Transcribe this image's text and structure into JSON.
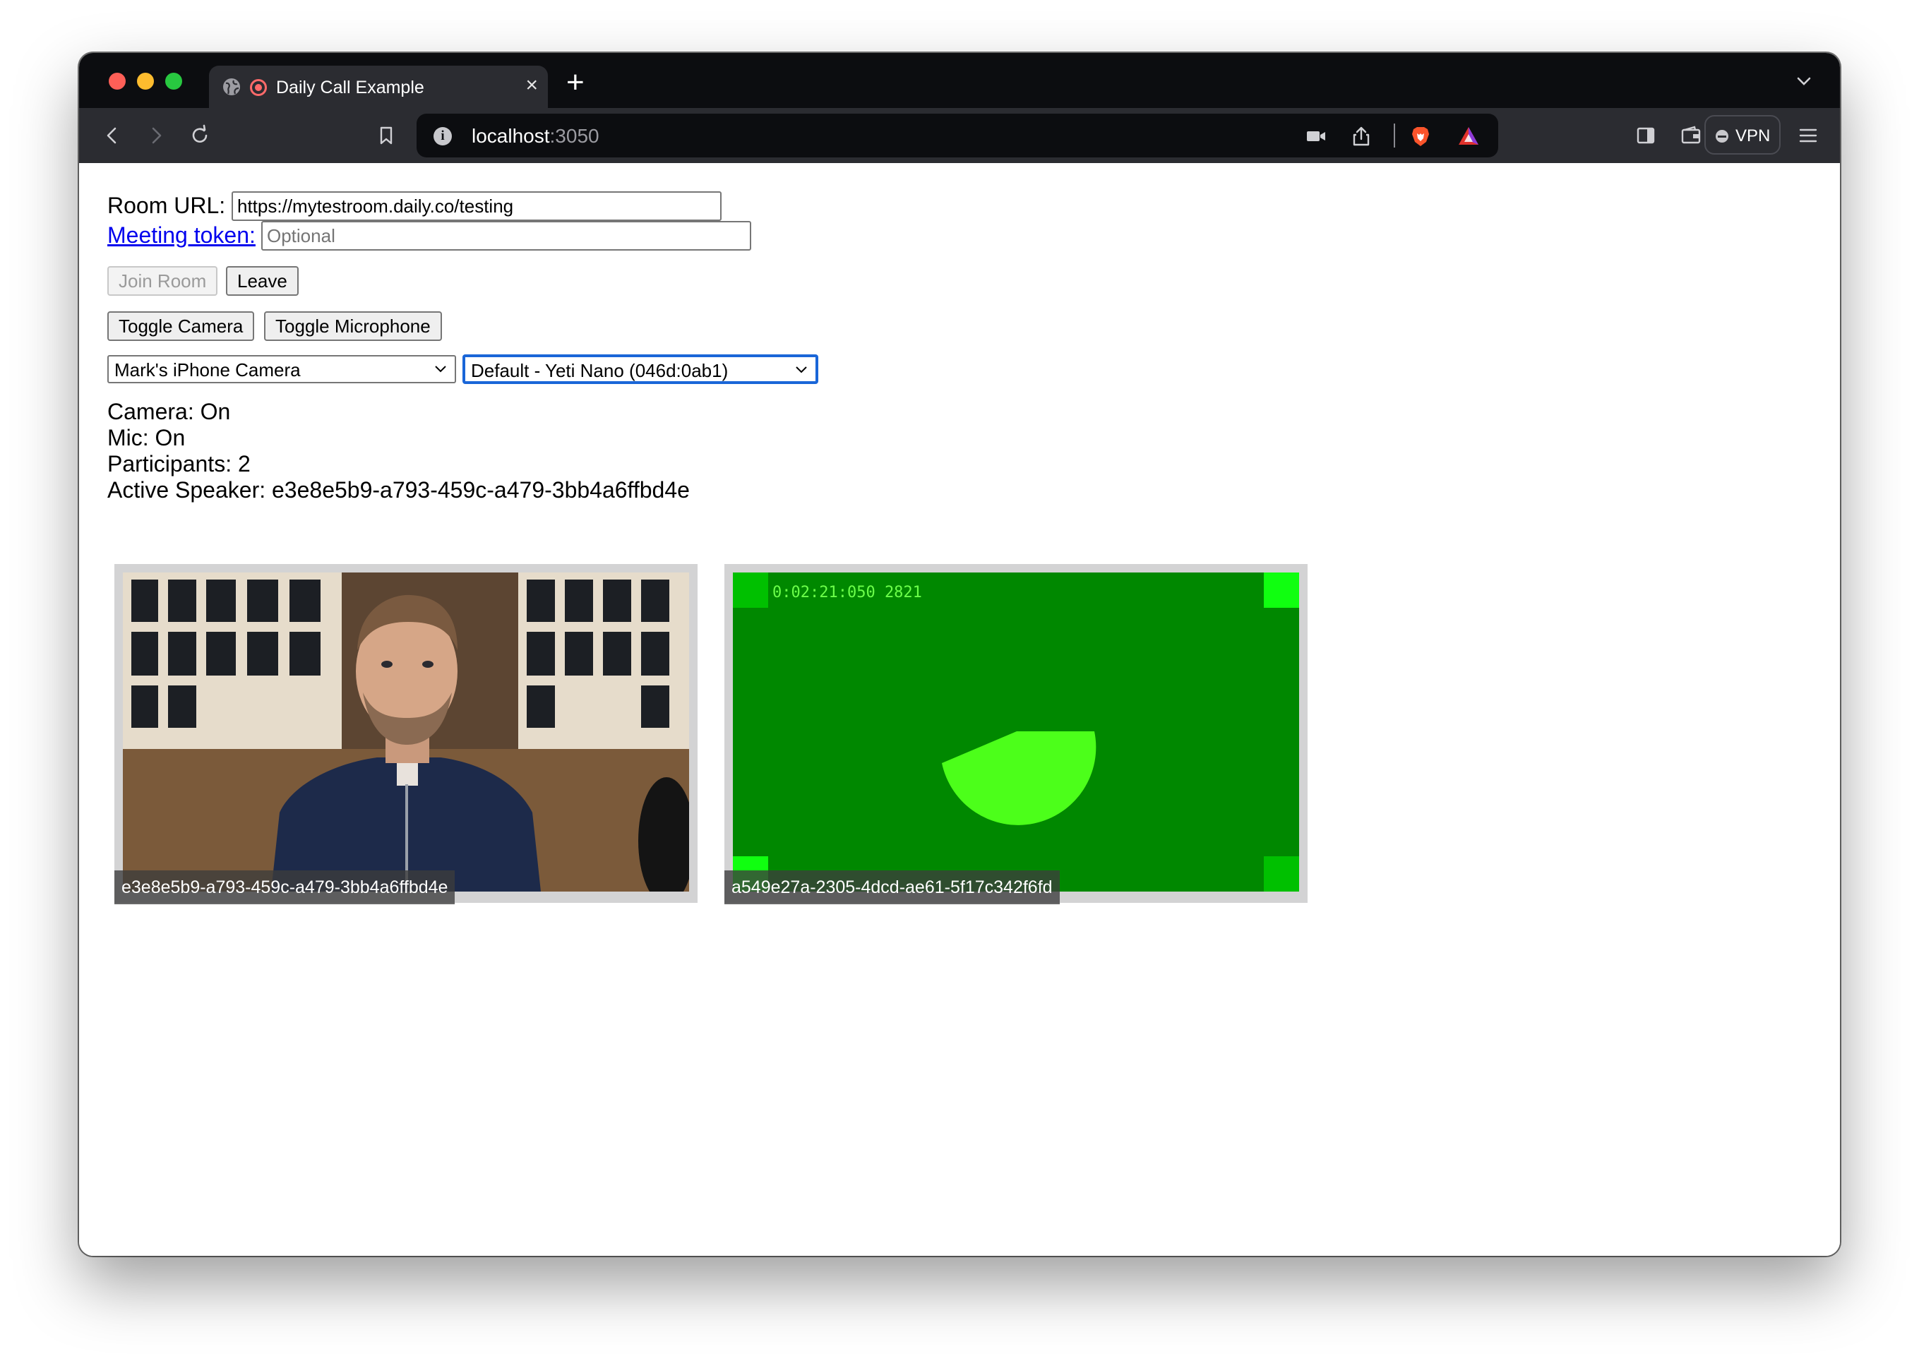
{
  "browser": {
    "tab_title": "Daily Call Example",
    "tab_close": "×",
    "new_tab": "+",
    "url_host": "localhost",
    "url_port": ":3050",
    "vpn_label": "VPN"
  },
  "room": {
    "url_label": "Room URL:",
    "url_value": "https://mytestroom.daily.co/testing",
    "token_label": "Meeting token:",
    "token_placeholder": "Optional"
  },
  "buttons": {
    "join": "Join Room",
    "leave": "Leave",
    "toggle_camera": "Toggle Camera",
    "toggle_microphone": "Toggle Microphone"
  },
  "devices": {
    "camera_selected": "Mark's iPhone Camera",
    "mic_selected": "Default - Yeti Nano (046d:0ab1)"
  },
  "status": {
    "camera": "Camera: On",
    "mic": "Mic: On",
    "participants": "Participants: 2",
    "active_speaker": "Active Speaker: e3e8e5b9-a793-459c-a479-3bb4a6ffbd4e"
  },
  "participants": [
    {
      "id": "e3e8e5b9-a793-459c-a479-3bb4a6ffbd4e"
    },
    {
      "id": "a549e27a-2305-4dcd-ae61-5f17c342f6fd",
      "timecode": "0:02:21:050 2821"
    }
  ],
  "colors": {
    "test_pattern_bg": "#008800",
    "test_pattern_shape": "#4cff1a",
    "focus_ring": "#1a66d8",
    "link": "#0000ee"
  },
  "icons": {
    "tab": [
      "globe-icon",
      "recording-icon"
    ],
    "toolbar": [
      "back-icon",
      "forward-icon",
      "reload-icon",
      "bookmark-icon",
      "info-icon",
      "camera-icon",
      "share-icon",
      "brave-lion-icon",
      "brave-rewards-icon",
      "sidebar-icon",
      "wallet-icon",
      "menu-icon"
    ]
  }
}
